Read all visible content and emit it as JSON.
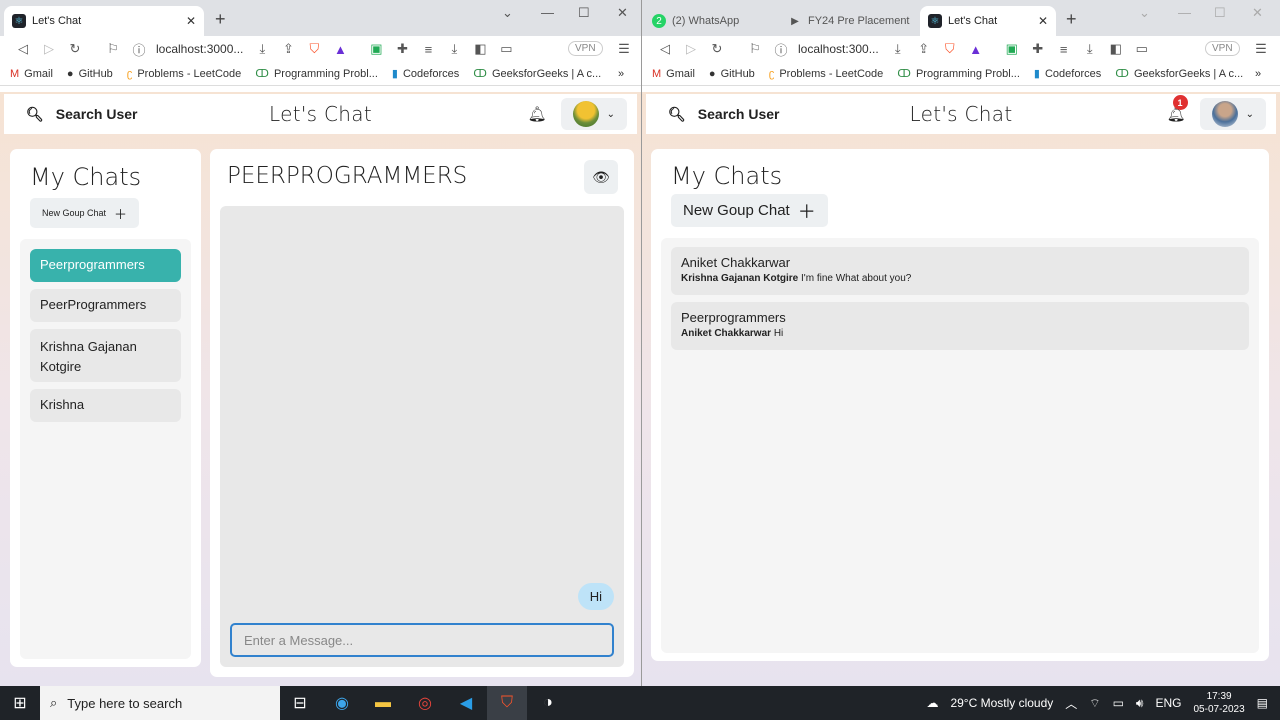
{
  "window_left": {
    "tab_title": "Let's Chat",
    "url": "localhost:3000...",
    "vpn_label": "VPN"
  },
  "window_right": {
    "tabs": [
      {
        "title": "(2) WhatsApp"
      },
      {
        "title": "FY24 Pre Placement"
      },
      {
        "title": "Let's Chat"
      }
    ],
    "url": "localhost:300...",
    "vpn_label": "VPN"
  },
  "bookmarks": [
    {
      "label": "Gmail",
      "icon": "gmail-icon"
    },
    {
      "label": "GitHub",
      "icon": "github-icon"
    },
    {
      "label": "Problems - LeetCode",
      "icon": "leetcode-icon"
    },
    {
      "label": "Programming Probl...",
      "icon": "gfg-icon"
    },
    {
      "label": "Codeforces",
      "icon": "codeforces-icon"
    },
    {
      "label": "GeeksforGeeks | A c...",
      "icon": "gfg-icon"
    }
  ],
  "app": {
    "search_label": "Search User",
    "title": "Let's Chat",
    "my_chats_title": "My Chats",
    "new_group_label": "New Goup Chat"
  },
  "left": {
    "chats": [
      {
        "name": "Peerprogrammers",
        "selected": true
      },
      {
        "name": "PeerProgrammers",
        "selected": false
      },
      {
        "name": "Krishna Gajanan Kotgire",
        "selected": false
      },
      {
        "name": "Krishna",
        "selected": false
      }
    ],
    "chat_title": "PEERPROGRAMMERS",
    "messages": [
      {
        "text": "Hi",
        "own": true
      }
    ],
    "input_placeholder": "Enter a Message..."
  },
  "right": {
    "notification_count": "1",
    "chats": [
      {
        "name": "Aniket Chakkarwar",
        "sender": "Krishna Gajanan Kotgire",
        "preview": "I'm fine What about you?"
      },
      {
        "name": "Peerprogrammers",
        "sender": "Aniket Chakkarwar",
        "preview": "Hi"
      }
    ]
  },
  "taskbar": {
    "search_placeholder": "Type here to search",
    "weather": "29°C  Mostly cloudy",
    "language": "ENG",
    "time": "17:39",
    "date": "05-07-2023"
  },
  "colors": {
    "selected_chat": "#38b2ac",
    "bubble_own": "#bee3f8",
    "input_focus": "#3182ce",
    "badge": "#e03030"
  }
}
